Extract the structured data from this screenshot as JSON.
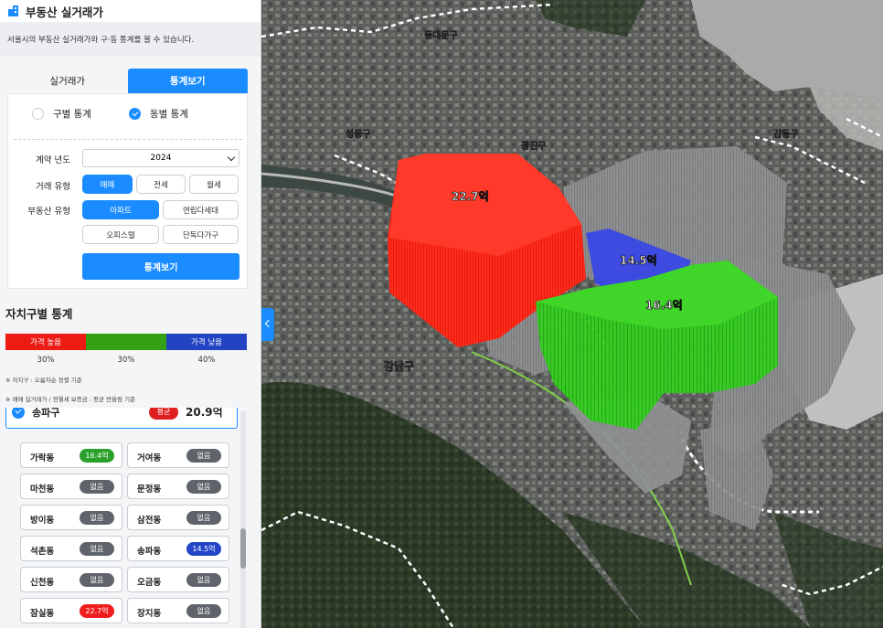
{
  "app": {
    "title": "부동산 실거래가",
    "description": "서울시의 부동산 실거래가와 구·동 통계를 볼 수 있습니다."
  },
  "tabs": [
    {
      "label": "실거래가",
      "active": false
    },
    {
      "label": "통계보기",
      "active": true
    }
  ],
  "filters": {
    "radio_gu": "구별 통계",
    "radio_dong": "동별 통계",
    "year_label": "계약 년도",
    "year_value": "2024",
    "deal_label": "거래 유형",
    "deal_options": [
      "매매",
      "전세",
      "월세"
    ],
    "property_label": "부동산 유형",
    "property_options": [
      "아파트",
      "연립다세대",
      "오피스텔",
      "단독다가구"
    ],
    "submit_label": "통계보기"
  },
  "stats": {
    "section_title": "자치구별 통계",
    "legend": {
      "high": "가격 높음",
      "mid": "",
      "low": "가격 낮음",
      "colors": [
        "#ee1b14",
        "#33a113",
        "#2244c3"
      ]
    },
    "percents": [
      "30%",
      "30%",
      "40%"
    ],
    "note1": "※ 자치구 : 오름차순 정렬 기준",
    "note2": "※ 매매 실거래가 / 전월세 보증금 : 평균 반올림 기준"
  },
  "selected_gu": {
    "name": "송파구",
    "avg_label": "평균",
    "avg_value": "20.9억"
  },
  "dongs": [
    {
      "name": "가락동",
      "badge": "16.4억",
      "color": "green"
    },
    {
      "name": "거여동",
      "badge": "없음",
      "color": "none"
    },
    {
      "name": "마천동",
      "badge": "없음",
      "color": "none"
    },
    {
      "name": "문정동",
      "badge": "없음",
      "color": "none"
    },
    {
      "name": "방이동",
      "badge": "없음",
      "color": "none"
    },
    {
      "name": "삼전동",
      "badge": "없음",
      "color": "none"
    },
    {
      "name": "석촌동",
      "badge": "없음",
      "color": "none"
    },
    {
      "name": "송파동",
      "badge": "14.5억",
      "color": "blue"
    },
    {
      "name": "신천동",
      "badge": "없음",
      "color": "none"
    },
    {
      "name": "오금동",
      "badge": "없음",
      "color": "none"
    },
    {
      "name": "잠실동",
      "badge": "22.7억",
      "color": "red"
    },
    {
      "name": "장지동",
      "badge": "없음",
      "color": "none"
    }
  ],
  "map": {
    "gu_labels": [
      "동대문구",
      "성동구",
      "광진구",
      "강동구",
      "강남구"
    ],
    "extrusion_labels": [
      "22.7억",
      "14.5억",
      "16.4억"
    ],
    "colors": {
      "red": "#ff2a1a",
      "green": "#2ec81a",
      "blue": "#3a48e6",
      "gray": "#8d8f91"
    }
  }
}
